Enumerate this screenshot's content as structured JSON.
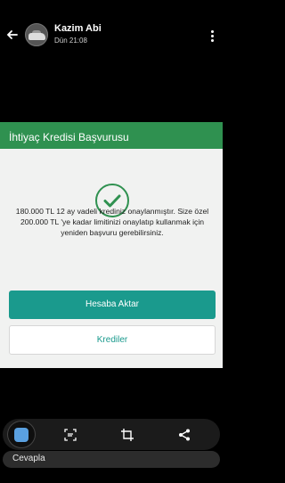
{
  "header": {
    "contact_name": "Kazim Abi",
    "timestamp": "Dün 21:08",
    "back_icon": "arrow-left-icon",
    "menu_icon": "more-vertical-icon"
  },
  "card": {
    "title": "İhtiyaç Kredisi Başvurusu",
    "success_icon": "check-circle-icon",
    "message": "180.000 TL 12 ay vadeli krediniz onaylanmıştır. Size özel 200.000 TL 'ye kadar limitinizi onaylatıp kullanmak için yeniden başvuru gerebilirsiniz.",
    "primary_button": "Hesaba Aktar",
    "secondary_button": "Krediler",
    "accent_color": "#2f9150",
    "button_color": "#1a9a8d"
  },
  "toolbar": {
    "icons": [
      "sticker-icon",
      "scan-text-icon",
      "crop-icon",
      "share-icon"
    ]
  },
  "reply": {
    "label": "Cevapla"
  }
}
